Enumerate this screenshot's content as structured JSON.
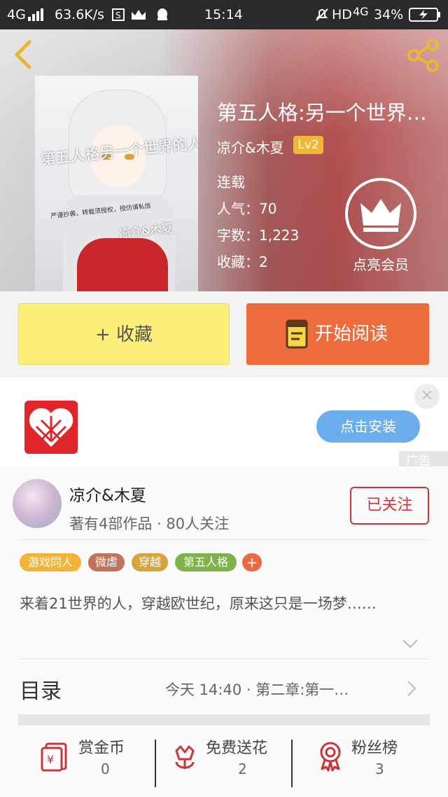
{
  "status_bar": {
    "left": "4G",
    "speed": "63.6K/s",
    "time": "15:14",
    "right": "HD",
    "network": "4G",
    "battery": "34%"
  },
  "book": {
    "title": "第五人格:另一个世界…",
    "author": "凉介&木夏",
    "level": "Lv2",
    "status": "连载",
    "popularity": "人气：70",
    "word_count": "字数：1,223",
    "favorites": "收藏：2",
    "vip_label": "点亮会员",
    "cover_text": {
      "line1": "第五人格另一个世界的人",
      "line2": "严谨抄袭，转载须授权，授仿请私信",
      "line3": "凉介&木夏"
    }
  },
  "actions": {
    "collect": "+ 收藏",
    "read": "开始阅读"
  },
  "ad": {
    "install": "点击安装",
    "close": "×",
    "tag": "广告"
  },
  "author_card": {
    "name": "凉介&木夏",
    "stats": "著有4部作品 · 80人关注",
    "follow": "已关注"
  },
  "tags": [
    "游戏同人",
    "微虐",
    "穿越",
    "第五人格"
  ],
  "tag_colors": [
    "#f3b336",
    "#c0735a",
    "#d9a33b",
    "#7fb24b"
  ],
  "tag_plus": "+",
  "description": "来着21世界的人，穿越欧世纪，原来这只是一场梦……",
  "toc": {
    "label": "目录",
    "latest": "今天 14:40 · 第二章:第一…"
  },
  "bottom": [
    {
      "label": "赏金币",
      "value": "0",
      "icon": "gold-coin-icon"
    },
    {
      "label": "免费送花",
      "value": "2",
      "icon": "flower-icon"
    },
    {
      "label": "粉丝榜",
      "value": "3",
      "icon": "medal-icon"
    }
  ]
}
